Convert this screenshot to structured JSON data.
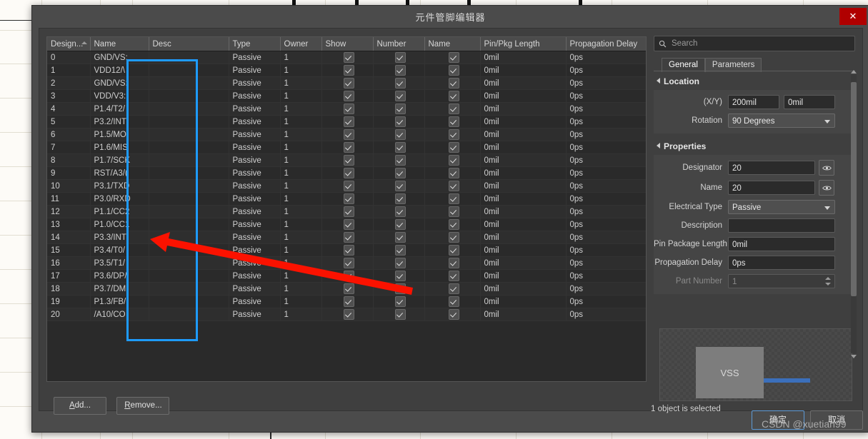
{
  "background": {
    "app_hint": "spreadsheet-grid"
  },
  "dialog": {
    "title": "元件管脚编辑器",
    "close_label": "✕"
  },
  "table": {
    "columns": [
      "Design...",
      "Name",
      "Desc",
      "Type",
      "Owner",
      "Show",
      "Number",
      "Name",
      "Pin/Pkg Length",
      "Propagation Delay"
    ],
    "rows": [
      {
        "designator": "0",
        "name": "GND/VS:",
        "desc": "",
        "type": "Passive",
        "owner": "1",
        "show": true,
        "number": true,
        "name2": true,
        "pkglen": "0mil",
        "delay": "0ps"
      },
      {
        "designator": "1",
        "name": "VDD12/\\",
        "desc": "",
        "type": "Passive",
        "owner": "1",
        "show": true,
        "number": true,
        "name2": true,
        "pkglen": "0mil",
        "delay": "0ps"
      },
      {
        "designator": "2",
        "name": "GND/VS:",
        "desc": "",
        "type": "Passive",
        "owner": "1",
        "show": true,
        "number": true,
        "name2": true,
        "pkglen": "0mil",
        "delay": "0ps"
      },
      {
        "designator": "3",
        "name": "VDD/V3:",
        "desc": "",
        "type": "Passive",
        "owner": "1",
        "show": true,
        "number": true,
        "name2": true,
        "pkglen": "0mil",
        "delay": "0ps"
      },
      {
        "designator": "4",
        "name": "P1.4/T2/",
        "desc": "",
        "type": "Passive",
        "owner": "1",
        "show": true,
        "number": true,
        "name2": true,
        "pkglen": "0mil",
        "delay": "0ps"
      },
      {
        "designator": "5",
        "name": "P3.2/INT",
        "desc": "",
        "type": "Passive",
        "owner": "1",
        "show": true,
        "number": true,
        "name2": true,
        "pkglen": "0mil",
        "delay": "0ps"
      },
      {
        "designator": "6",
        "name": "P1.5/MO",
        "desc": "",
        "type": "Passive",
        "owner": "1",
        "show": true,
        "number": true,
        "name2": true,
        "pkglen": "0mil",
        "delay": "0ps"
      },
      {
        "designator": "7",
        "name": "P1.6/MIS",
        "desc": "",
        "type": "Passive",
        "owner": "1",
        "show": true,
        "number": true,
        "name2": true,
        "pkglen": "0mil",
        "delay": "0ps"
      },
      {
        "designator": "8",
        "name": "P1.7/SCK",
        "desc": "",
        "type": "Passive",
        "owner": "1",
        "show": true,
        "number": true,
        "name2": true,
        "pkglen": "0mil",
        "delay": "0ps"
      },
      {
        "designator": "9",
        "name": "RST/A3/(",
        "desc": "",
        "type": "Passive",
        "owner": "1",
        "show": true,
        "number": true,
        "name2": true,
        "pkglen": "0mil",
        "delay": "0ps"
      },
      {
        "designator": "10",
        "name": "P3.1/TXD",
        "desc": "",
        "type": "Passive",
        "owner": "1",
        "show": true,
        "number": true,
        "name2": true,
        "pkglen": "0mil",
        "delay": "0ps"
      },
      {
        "designator": "11",
        "name": "P3.0/RXD",
        "desc": "",
        "type": "Passive",
        "owner": "1",
        "show": true,
        "number": true,
        "name2": true,
        "pkglen": "0mil",
        "delay": "0ps"
      },
      {
        "designator": "12",
        "name": "P1.1/CC2",
        "desc": "",
        "type": "Passive",
        "owner": "1",
        "show": true,
        "number": true,
        "name2": true,
        "pkglen": "0mil",
        "delay": "0ps"
      },
      {
        "designator": "13",
        "name": "P1.0/CC1",
        "desc": "",
        "type": "Passive",
        "owner": "1",
        "show": true,
        "number": true,
        "name2": true,
        "pkglen": "0mil",
        "delay": "0ps"
      },
      {
        "designator": "14",
        "name": "P3.3/INT",
        "desc": "",
        "type": "Passive",
        "owner": "1",
        "show": true,
        "number": true,
        "name2": true,
        "pkglen": "0mil",
        "delay": "0ps"
      },
      {
        "designator": "15",
        "name": "P3.4/T0/",
        "desc": "",
        "type": "Passive",
        "owner": "1",
        "show": true,
        "number": true,
        "name2": true,
        "pkglen": "0mil",
        "delay": "0ps"
      },
      {
        "designator": "16",
        "name": "P3.5/T1/",
        "desc": "",
        "type": "Passive",
        "owner": "1",
        "show": true,
        "number": true,
        "name2": true,
        "pkglen": "0mil",
        "delay": "0ps"
      },
      {
        "designator": "17",
        "name": "P3.6/DP/",
        "desc": "",
        "type": "Passive",
        "owner": "1",
        "show": true,
        "number": true,
        "name2": true,
        "pkglen": "0mil",
        "delay": "0ps"
      },
      {
        "designator": "18",
        "name": "P3.7/DM",
        "desc": "",
        "type": "Passive",
        "owner": "1",
        "show": true,
        "number": true,
        "name2": true,
        "pkglen": "0mil",
        "delay": "0ps"
      },
      {
        "designator": "19",
        "name": "P1.3/FB/",
        "desc": "",
        "type": "Passive",
        "owner": "1",
        "show": true,
        "number": true,
        "name2": true,
        "pkglen": "0mil",
        "delay": "0ps"
      },
      {
        "designator": "20",
        "name": "/A10/CO",
        "desc": "",
        "type": "Passive",
        "owner": "1",
        "show": true,
        "number": true,
        "name2": true,
        "pkglen": "0mil",
        "delay": "0ps"
      }
    ],
    "add_button": {
      "prefix": "",
      "mnemonic": "A",
      "suffix": "dd..."
    },
    "remove_button": {
      "prefix": "",
      "mnemonic": "R",
      "suffix": "emove..."
    }
  },
  "properties_panel": {
    "search_placeholder": "Search",
    "tabs": [
      {
        "label": "General",
        "active": true
      },
      {
        "label": "Parameters",
        "active": false
      }
    ],
    "location": {
      "heading": "Location",
      "xy_label": "(X/Y)",
      "x_value": "200mil",
      "y_value": "0mil",
      "rotation_label": "Rotation",
      "rotation_value": "90 Degrees"
    },
    "properties": {
      "heading": "Properties",
      "fields": [
        {
          "label": "Designator",
          "value": "20",
          "kind": "text-eye"
        },
        {
          "label": "Name",
          "value": "20",
          "kind": "text-eye"
        },
        {
          "label": "Electrical Type",
          "value": "Passive",
          "kind": "select"
        },
        {
          "label": "Description",
          "value": "",
          "kind": "text"
        },
        {
          "label": "Pin Package Length",
          "value": "0mil",
          "kind": "text"
        },
        {
          "label": "Propagation Delay",
          "value": "0ps",
          "kind": "text"
        },
        {
          "label": "Part Number",
          "value": "1",
          "kind": "spin",
          "disabled": true
        }
      ]
    },
    "preview": {
      "pin_name": "VSS"
    },
    "status": "1 object is selected"
  },
  "footer": {
    "ok_label": "确定",
    "cancel_label": "取消"
  },
  "watermark": "CSDN @xuetian99",
  "accent_colors": {
    "highlight_box": "#1e9bff",
    "annotation_arrow": "#fb1200",
    "close_button": "#b00000",
    "pin_preview": "#3b6fbb"
  }
}
